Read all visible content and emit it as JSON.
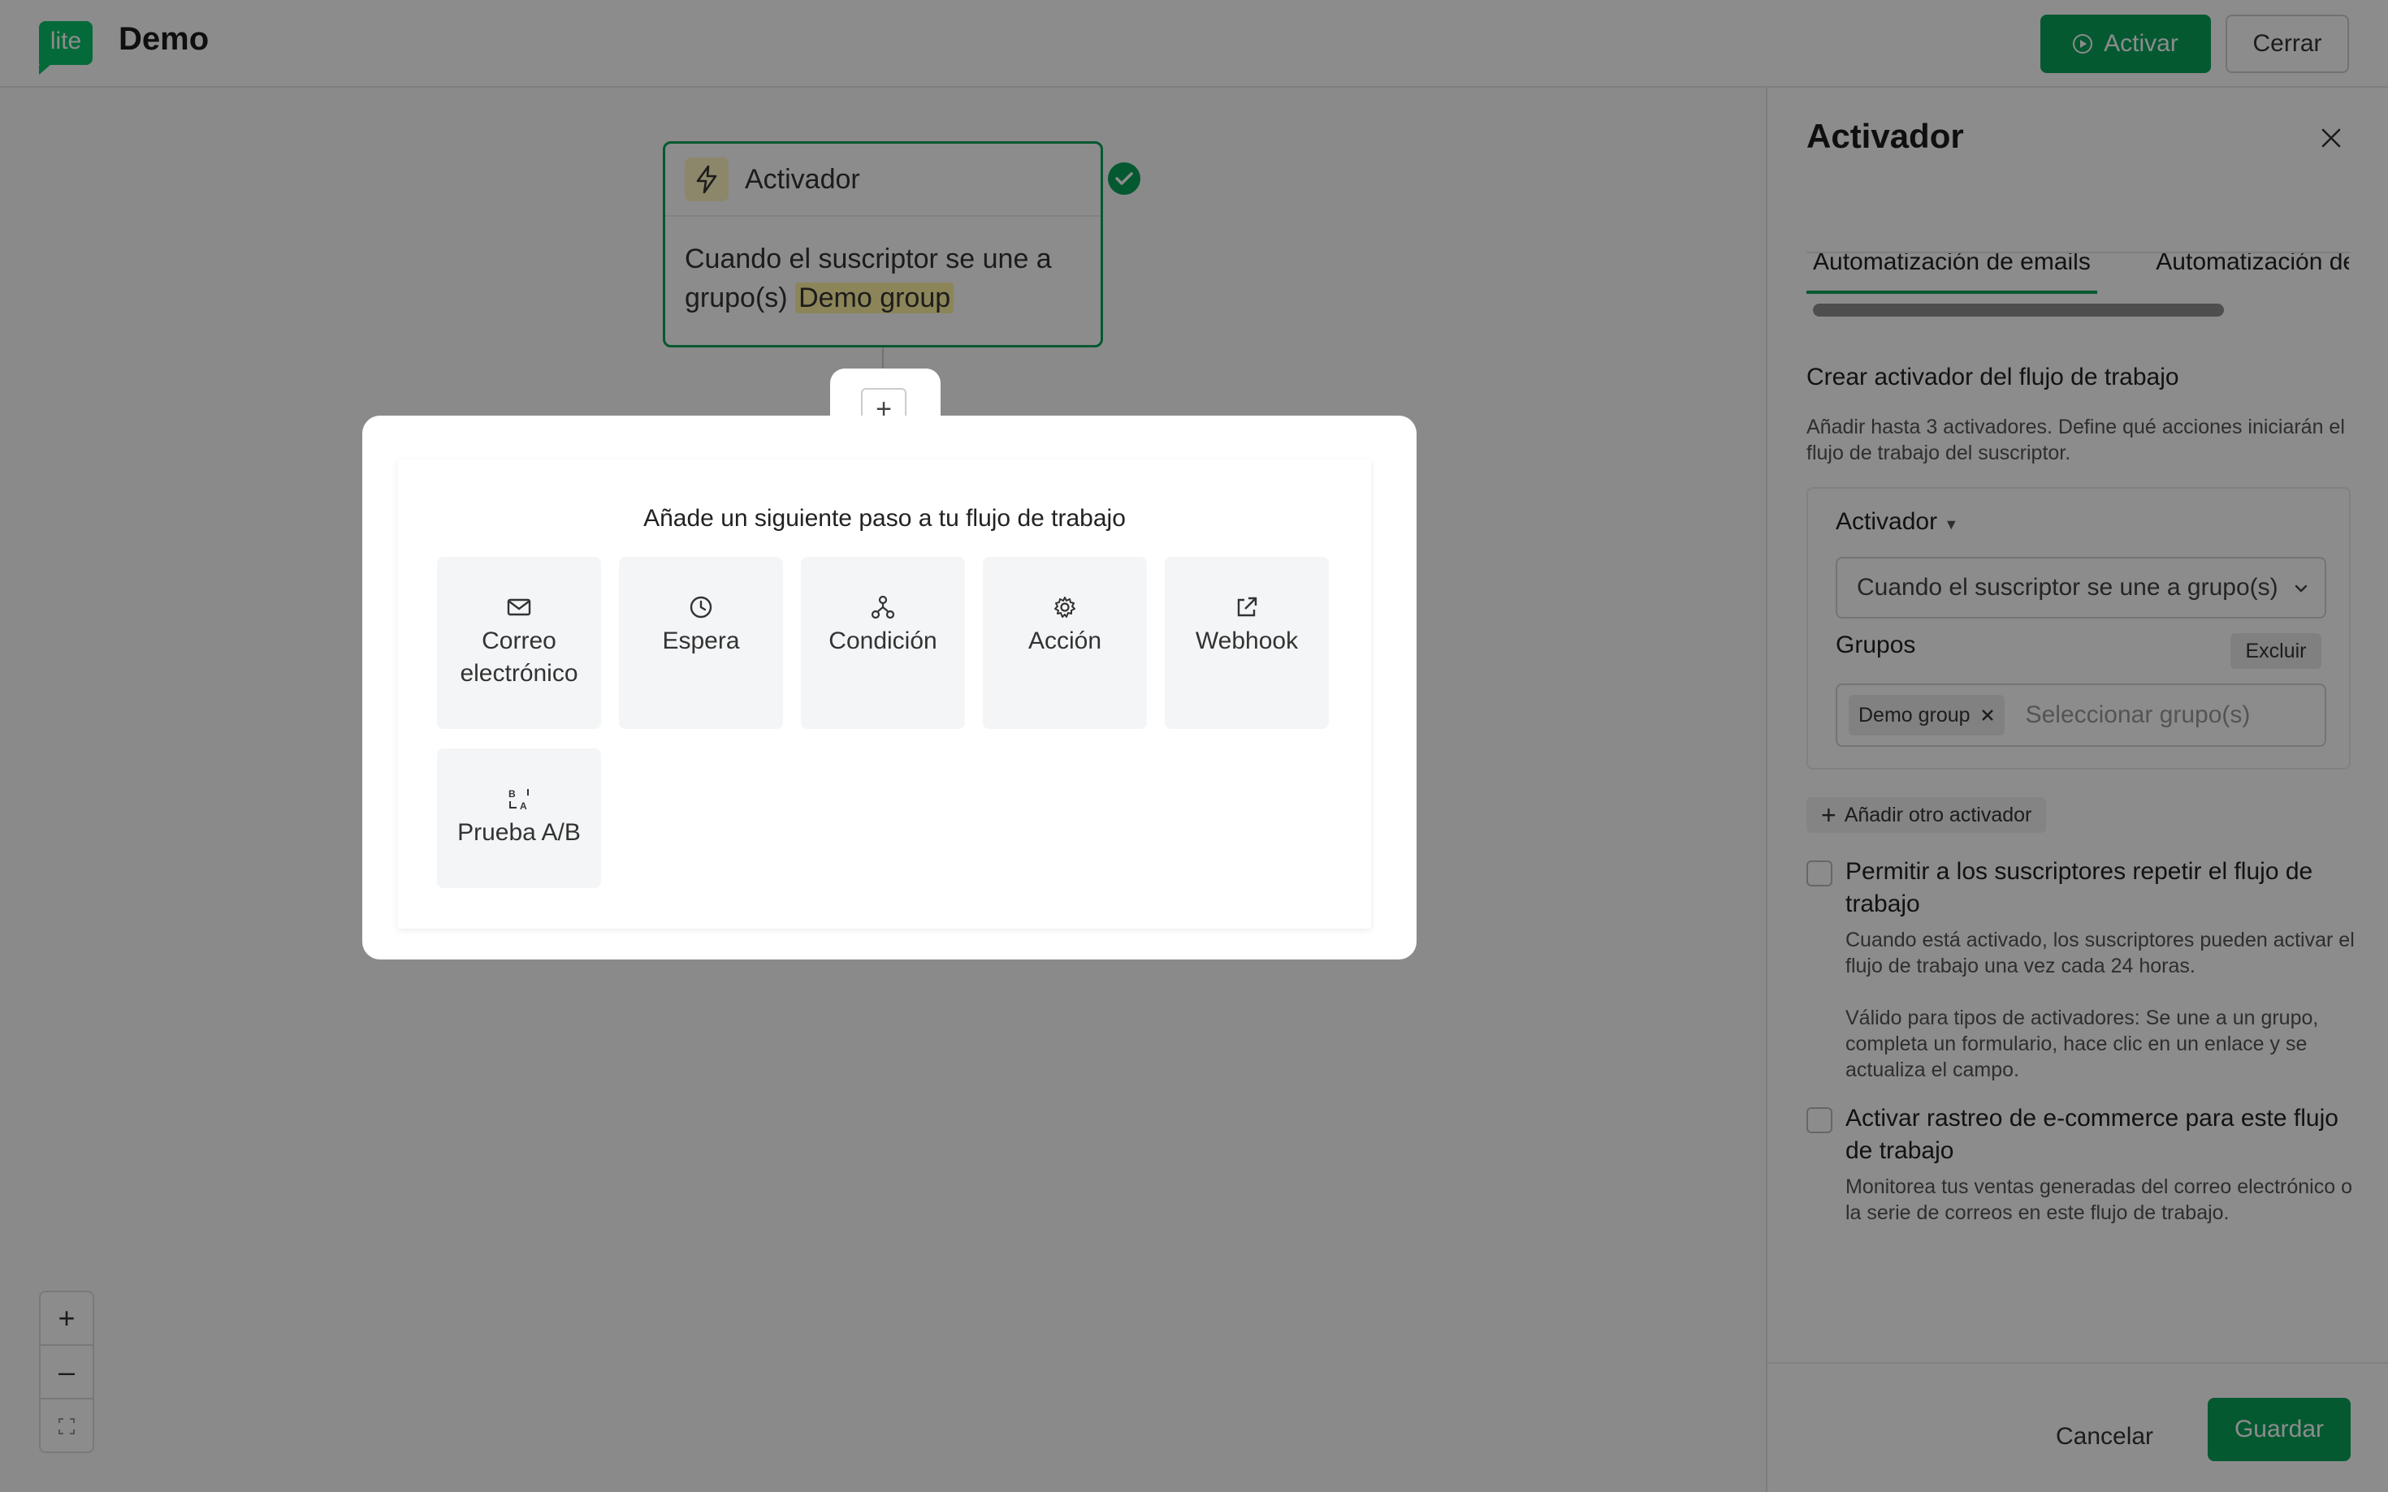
{
  "app": {
    "logo_text": "lite",
    "title": "Demo",
    "activate_label": "Activar",
    "close_label": "Cerrar"
  },
  "canvas": {
    "node": {
      "title": "Activador",
      "text_prefix": "Cuando el suscriptor se une a grupo(s)",
      "highlight": "Demo group"
    },
    "add_step_symbol": "+",
    "popup": {
      "title": "Añade un siguiente paso a tu flujo de trabajo",
      "steps": [
        {
          "label": "Correo electrónico",
          "icon": "mail-icon"
        },
        {
          "label": "Espera",
          "icon": "clock-icon"
        },
        {
          "label": "Condición",
          "icon": "branch-icon"
        },
        {
          "label": "Acción",
          "icon": "gear-icon"
        },
        {
          "label": "Webhook",
          "icon": "external-link-icon"
        },
        {
          "label": "Prueba A/B",
          "icon": "ab-test-icon"
        }
      ]
    },
    "zoom": {
      "in": "+",
      "out": "–"
    }
  },
  "panel": {
    "title": "Activador",
    "tabs": [
      "Automatización de emails",
      "Automatización de"
    ],
    "section_title": "Crear activador del flujo de trabajo",
    "section_desc": "Añadir hasta 3 activadores. Define qué acciones iniciarán el flujo de trabajo del suscriptor.",
    "trigger_label": "Activador",
    "trigger_value": "Cuando el suscriptor se une a grupo(s)",
    "groups_label": "Grupos",
    "exclude_label": "Excluir",
    "group_chip": "Demo group",
    "groups_placeholder": "Seleccionar grupo(s)",
    "add_trigger_label": "Añadir otro activador",
    "option1": {
      "title": "Permitir a los suscriptores repetir el flujo de trabajo",
      "desc1": "Cuando está activado, los suscriptores pueden activar el flujo de trabajo una vez cada 24 horas.",
      "desc2": "Válido para tipos de activadores: Se une a un grupo, completa un formulario, hace clic en un enlace y se actualiza el campo."
    },
    "option2": {
      "title": "Activar rastreo de e-commerce para este flujo de trabajo",
      "desc": "Monitorea tus ventas generadas del correo electrónico o la serie de correos en este flujo de trabajo."
    },
    "cancel_label": "Cancelar",
    "save_label": "Guardar"
  },
  "colors": {
    "brand_green": "#09a25a",
    "highlight_yellow": "#fff3a3"
  }
}
